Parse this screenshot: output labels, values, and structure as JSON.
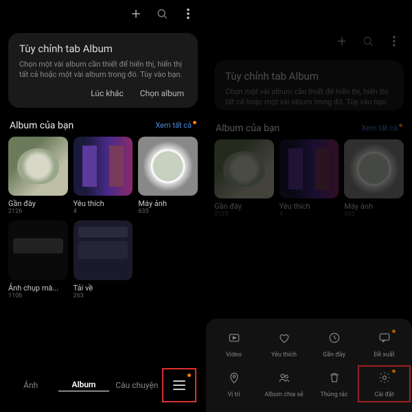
{
  "topbar": {},
  "card": {
    "title": "Tùy chỉnh tab Album",
    "body": "Chọn một vài album cần thiết để hiển thị, hiển thị tất cả hoặc một vài album trong đó. Tùy vào bạn.",
    "later": "Lúc khác",
    "choose": "Chọn album"
  },
  "section": {
    "title": "Album của bạn",
    "see_all": "Xem tất cả"
  },
  "albums_row1": [
    {
      "name": "Gần đây",
      "count": "2126"
    },
    {
      "name": "Yêu thích",
      "count": "4"
    },
    {
      "name": "Máy ảnh",
      "count": "635"
    }
  ],
  "albums_row2": [
    {
      "name": "Ảnh chụp mà...",
      "count": "1106"
    },
    {
      "name": "Tải về",
      "count": "263"
    }
  ],
  "albums_right": [
    {
      "name": "Gần đây",
      "count": "2125"
    },
    {
      "name": "Yêu thích",
      "count": "4"
    },
    {
      "name": "Máy ảnh",
      "count": "635"
    }
  ],
  "nav": {
    "photos": "Ảnh",
    "albums": "Album",
    "stories": "Câu chuyện"
  },
  "sheet": {
    "video": "Video",
    "favorite": "Yêu thích",
    "recent": "Gần đây",
    "suggest": "Đề xuất",
    "location": "Vị trí",
    "shared": "Album chia sẻ",
    "trash": "Thùng rác",
    "settings": "Cài đặt"
  }
}
